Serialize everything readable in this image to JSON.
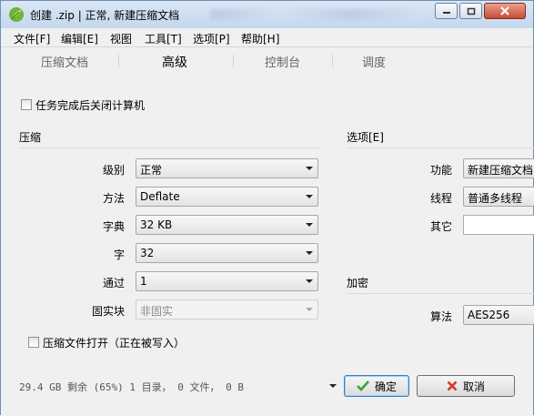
{
  "window": {
    "title": "创建 .zip | 正常, 新建压缩文档"
  },
  "menu": [
    "文件[F]",
    "编辑[E]",
    "视图",
    "工具[T]",
    "选项[P]",
    "帮助[H]"
  ],
  "tabs": [
    {
      "label": "压缩文档",
      "active": false
    },
    {
      "label": "高级",
      "active": true
    },
    {
      "label": "控制台",
      "active": false
    },
    {
      "label": "调度",
      "active": false
    }
  ],
  "shutdown_checkbox": {
    "label": "任务完成后关闭计算机",
    "checked": false
  },
  "compression": {
    "section_title": "压缩",
    "level_label": "级别",
    "level_value": "正常",
    "method_label": "方法",
    "method_value": "Deflate",
    "dictionary_label": "字典",
    "dictionary_value": "32 KB",
    "word_label": "字",
    "word_value": "32",
    "passes_label": "通过",
    "passes_value": "1",
    "solid_label": "固实块",
    "solid_value": "非固实"
  },
  "options": {
    "section_title": "选项[E]",
    "function_label": "功能",
    "function_value": "新建压缩文档",
    "threads_label": "线程",
    "threads_value": "普通多线程",
    "other_label": "其它",
    "other_value": ""
  },
  "encryption": {
    "section_title": "加密",
    "algorithm_label": "算法",
    "algorithm_value": "AES256"
  },
  "open_checkbox": {
    "label": "压缩文件打开（正在被写入）",
    "checked": false
  },
  "status_text": "29.4 GB 剩余 (65%)  1 目录， 0 文件， 0 B",
  "buttons": {
    "ok": "确定",
    "cancel": "取消"
  },
  "colors": {
    "ok_check": "#3aa335",
    "cancel_x": "#d03a2a"
  }
}
